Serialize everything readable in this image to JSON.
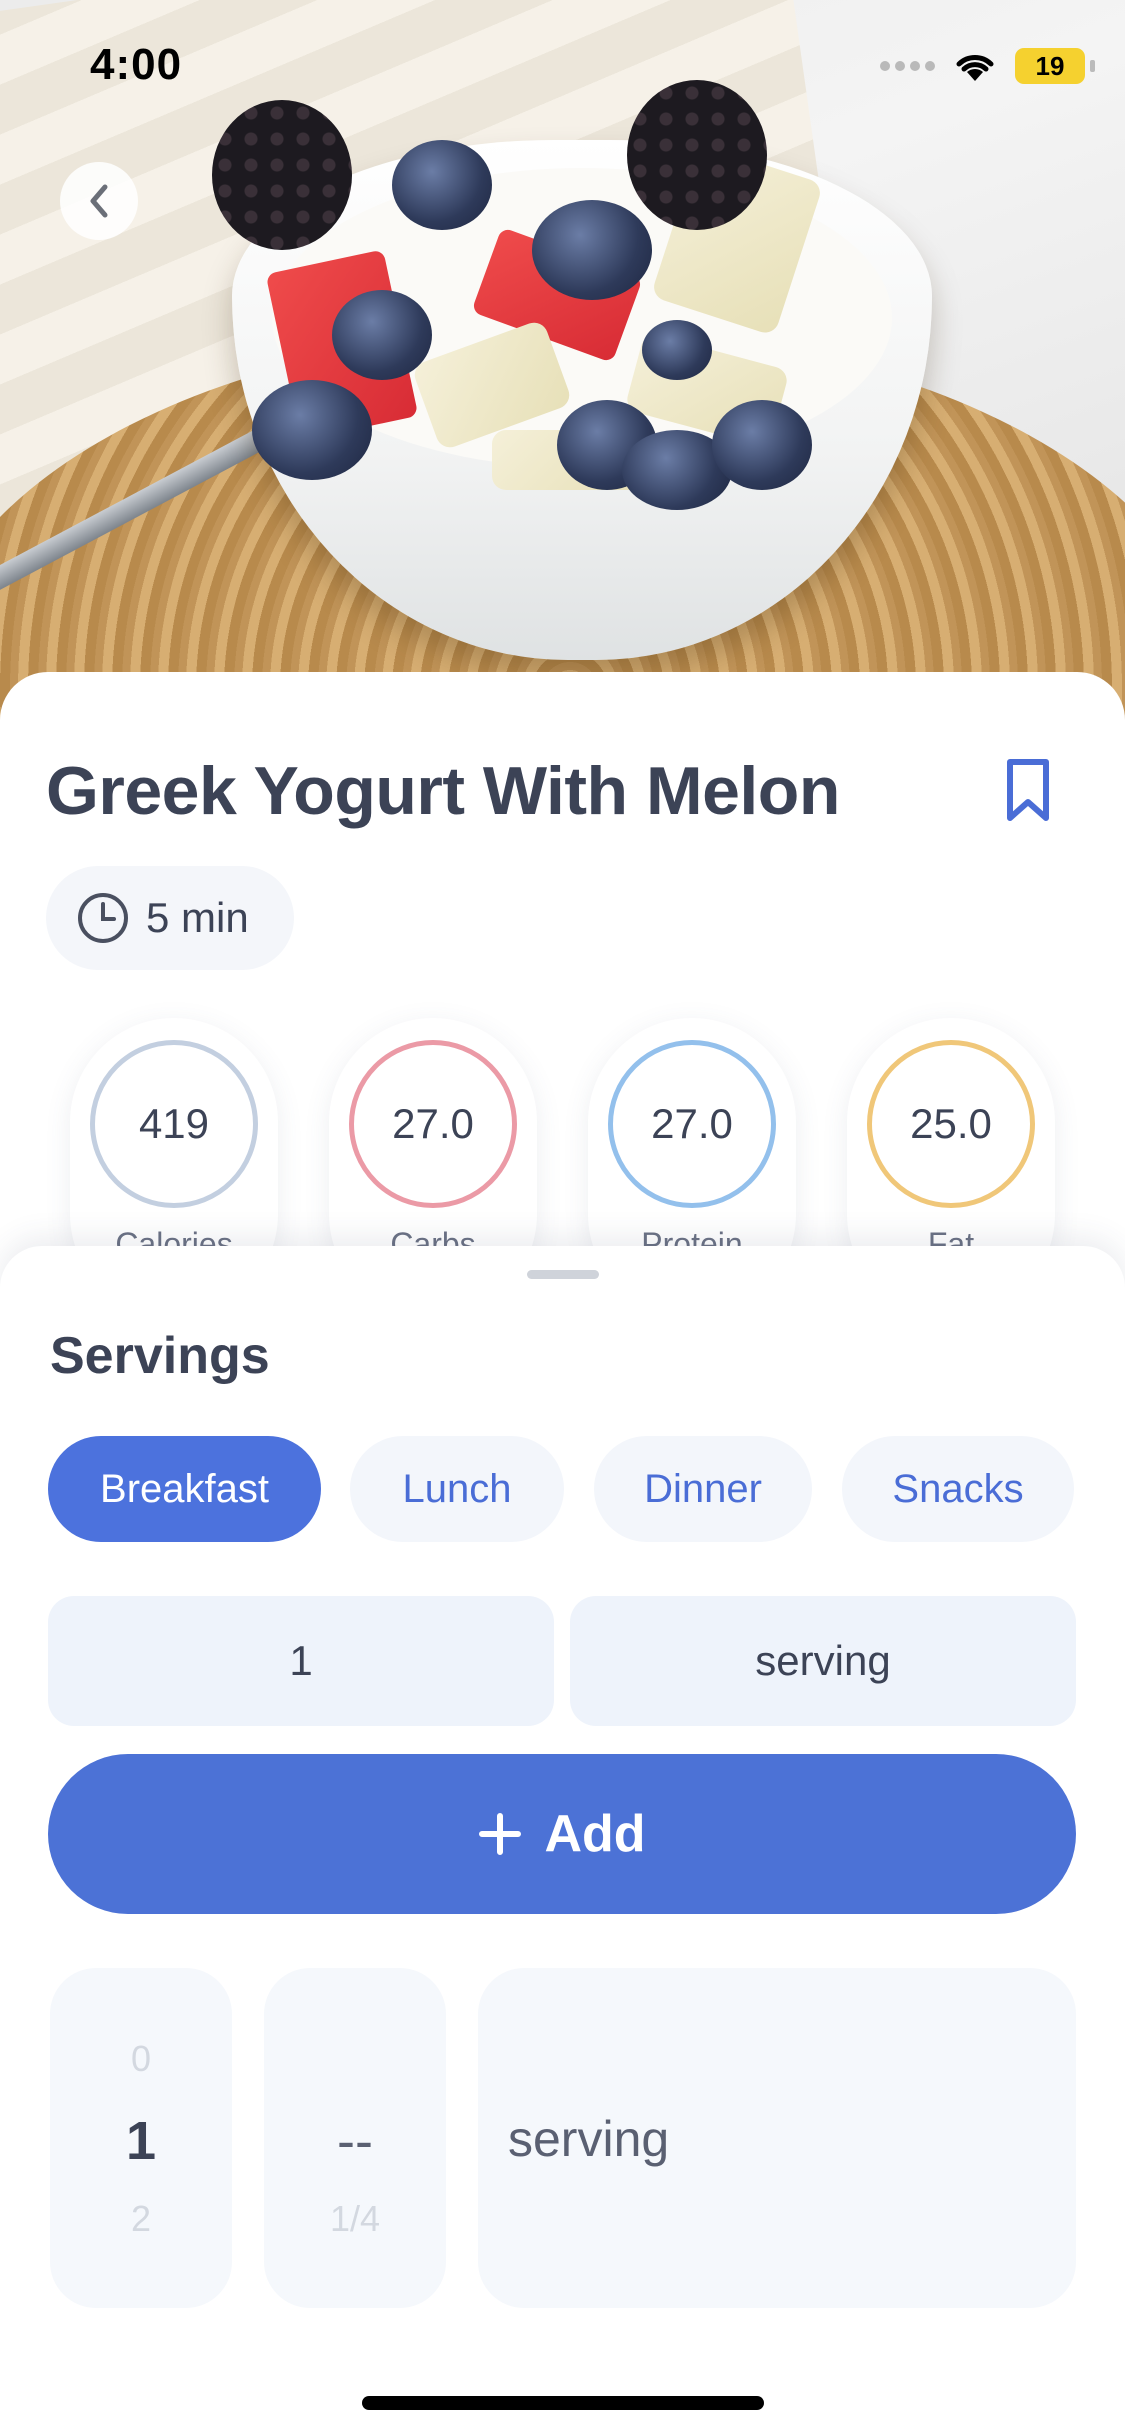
{
  "status_bar": {
    "time": "4:00",
    "battery": "19"
  },
  "recipe": {
    "title": "Greek Yogurt With Melon",
    "time": "5 min"
  },
  "macros": [
    {
      "value": "419",
      "label": "Calories",
      "color": "#c3cfe0"
    },
    {
      "value": "27.0",
      "label": "Carbs",
      "color": "#eb9aa6"
    },
    {
      "value": "27.0",
      "label": "Protein",
      "color": "#93c0ec"
    },
    {
      "value": "25.0",
      "label": "Fat",
      "color": "#f0c779"
    }
  ],
  "servings": {
    "title": "Servings",
    "meals": [
      "Breakfast",
      "Lunch",
      "Dinner",
      "Snacks"
    ],
    "selected_meal": "Breakfast",
    "amount": "1",
    "unit": "serving",
    "add_label": "Add",
    "picker": {
      "whole_above": "0",
      "whole_selected": "1",
      "whole_below": "2",
      "fraction_selected": "--",
      "fraction_below": "1/4",
      "unit_selected": "serving"
    }
  },
  "colors": {
    "accent": "#4c72dd"
  },
  "icons": [
    "back-arrow-icon",
    "bookmark-icon",
    "clock-icon",
    "plus-icon",
    "wifi-icon",
    "battery-icon"
  ]
}
